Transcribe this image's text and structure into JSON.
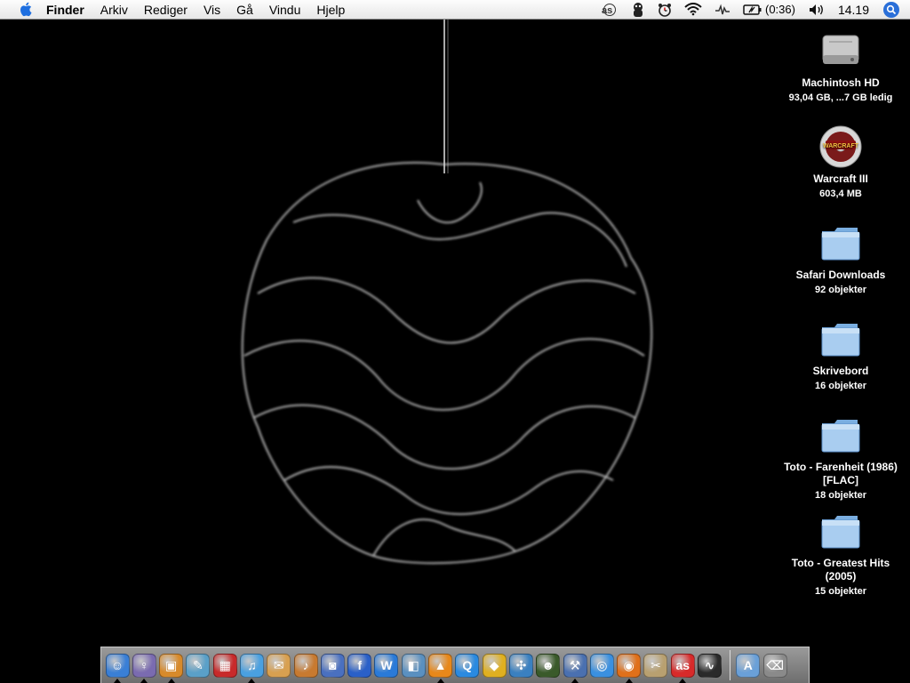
{
  "menubar": {
    "app_name": "Finder",
    "items": [
      "Arkiv",
      "Rediger",
      "Vis",
      "Gå",
      "Vindu",
      "Hjelp"
    ],
    "battery": "(0:36)",
    "clock": "14.19"
  },
  "desktop_icons": [
    {
      "name": "Machintosh HD",
      "sub": "93,04 GB, ...7 GB ledig",
      "icon": "hard-drive-icon"
    },
    {
      "name": "Warcraft III",
      "sub": "603,4 MB",
      "icon": "cd-disc-icon"
    },
    {
      "name": "Safari Downloads",
      "sub": "92 objekter",
      "icon": "folder-icon"
    },
    {
      "name": "Skrivebord",
      "sub": "16 objekter",
      "icon": "folder-icon"
    },
    {
      "name": "Toto - Farenheit (1986) [FLAC]",
      "sub": "18 objekter",
      "icon": "folder-icon"
    },
    {
      "name": "Toto - Greatest Hits (2005)",
      "sub": "15 objekter",
      "icon": "folder-icon"
    }
  ],
  "disc_label": "WARCRAFT",
  "dock": {
    "apps": [
      {
        "icon": "finder-icon",
        "color": "#3a7fd6",
        "glyph": "☺",
        "running": true
      },
      {
        "icon": "adium-icon",
        "color": "#7a6bb0",
        "glyph": "♀",
        "running": true
      },
      {
        "icon": "iphoto-icon",
        "color": "#d88a2a",
        "glyph": "▣",
        "running": true
      },
      {
        "icon": "mail-icon",
        "color": "#5aa0c8",
        "glyph": "✎",
        "running": false
      },
      {
        "icon": "red-app-icon",
        "color": "#c82a2a",
        "glyph": "▦",
        "running": false
      },
      {
        "icon": "itunes-icon",
        "color": "#4aa0e0",
        "glyph": "♫",
        "running": true
      },
      {
        "icon": "address-book-icon",
        "color": "#d8a050",
        "glyph": "✉",
        "running": false
      },
      {
        "icon": "garageband-icon",
        "color": "#c87a30",
        "glyph": "♪",
        "running": false
      },
      {
        "icon": "radio-icon",
        "color": "#4a70c0",
        "glyph": "◙",
        "running": false
      },
      {
        "icon": "font-icon",
        "color": "#2a60c8",
        "glyph": "f",
        "running": false
      },
      {
        "icon": "word-icon",
        "color": "#2a7ad8",
        "glyph": "W",
        "running": false
      },
      {
        "icon": "preview-icon",
        "color": "#5a90c0",
        "glyph": "◧",
        "running": false
      },
      {
        "icon": "vlc-icon",
        "color": "#e8881a",
        "glyph": "▲",
        "running": true
      },
      {
        "icon": "quicktime-icon",
        "color": "#2a8ae0",
        "glyph": "Q",
        "running": false
      },
      {
        "icon": "transmit-icon",
        "color": "#e0b020",
        "glyph": "◆",
        "running": false
      },
      {
        "icon": "network-icon",
        "color": "#3a80c0",
        "glyph": "✣",
        "running": false
      },
      {
        "icon": "warcraft-icon",
        "color": "#3a5a2a",
        "glyph": "☻",
        "running": false
      },
      {
        "icon": "xcode-icon",
        "color": "#4a70b0",
        "glyph": "⚒",
        "running": true
      },
      {
        "icon": "safari-icon",
        "color": "#3a90e0",
        "glyph": "◎",
        "running": false
      },
      {
        "icon": "firefox-icon",
        "color": "#e0701a",
        "glyph": "◉",
        "running": true
      },
      {
        "icon": "script-icon",
        "color": "#b8a070",
        "glyph": "✂",
        "running": false
      },
      {
        "icon": "lastfm-icon",
        "color": "#d82a2a",
        "glyph": "as",
        "running": true
      },
      {
        "icon": "activity-monitor-icon",
        "color": "#2a2a2a",
        "glyph": "∿",
        "running": false
      }
    ],
    "right_items": [
      {
        "icon": "applications-folder-icon",
        "color": "#6aa0d8",
        "glyph": "A"
      },
      {
        "icon": "trash-icon",
        "color": "#8a8a8a",
        "glyph": "⌫"
      }
    ]
  }
}
